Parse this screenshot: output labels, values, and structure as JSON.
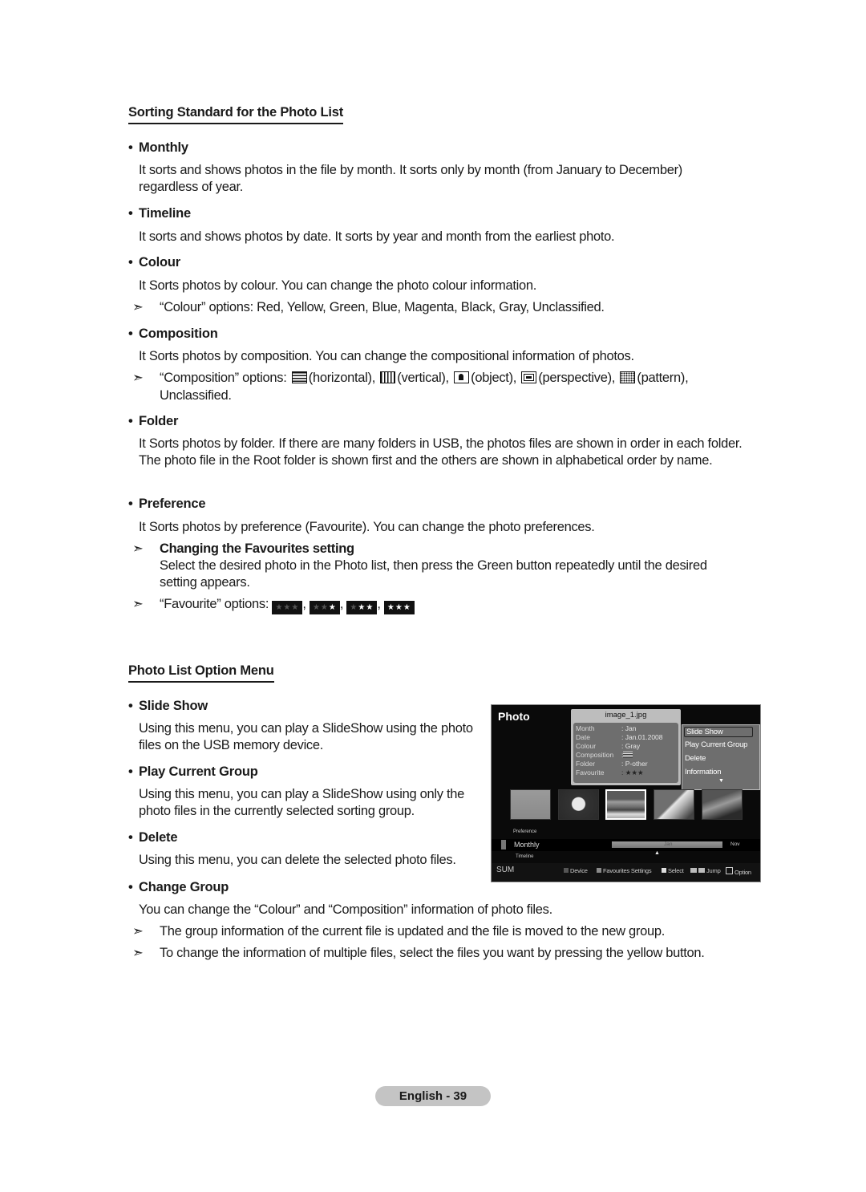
{
  "section1": {
    "title": "Sorting Standard for the Photo List",
    "items": [
      {
        "label": "Monthly",
        "description": "It sorts and shows photos in the file by month. It sorts only by month (from January to December) regardless of year."
      },
      {
        "label": "Timeline",
        "description": "It sorts and shows photos by date. It sorts by year and month from the earliest photo."
      },
      {
        "label": "Colour",
        "description": "It Sorts photos by colour. You can change the photo colour information.",
        "note": "“Colour” options: Red, Yellow, Green, Blue, Magenta, Black, Gray, Unclassified."
      },
      {
        "label": "Composition",
        "description": "It Sorts photos by composition. You can change the compositional information of photos.",
        "note_prefix": "“Composition” options:",
        "options": [
          {
            "icon": "horizontal-composition-icon",
            "label": "(horizontal),"
          },
          {
            "icon": "vertical-composition-icon",
            "label": "(vertical),"
          },
          {
            "icon": "object-composition-icon",
            "label": "(object),"
          },
          {
            "icon": "perspective-composition-icon",
            "label": "(perspective),"
          },
          {
            "icon": "pattern-composition-icon",
            "label": "(pattern),"
          }
        ],
        "note_suffix": "Unclassified."
      },
      {
        "label": "Folder",
        "description": "It Sorts photos by folder. If there are many folders in USB, the photos files are shown in order in each folder. The photo file in the Root folder is shown first and the others are shown in alphabetical order by name."
      },
      {
        "label": "Preference",
        "description": "It Sorts photos by preference (Favourite). You can change the photo preferences.",
        "subnote_title": "Changing the Favourites setting",
        "subnote_text": "Select the desired photo in the Photo list, then press the Green button repeatedly until the desired setting appears.",
        "fav_prefix": "“Favourite” options:",
        "fav_levels": [
          0,
          1,
          2,
          3
        ],
        "star": "★"
      }
    ]
  },
  "section2": {
    "title": "Photo List Option Menu",
    "items": [
      {
        "label": "Slide Show",
        "description": "Using this menu, you can play a SlideShow using the photo files on the USB memory device."
      },
      {
        "label": "Play Current Group",
        "description": "Using this menu, you can play a SlideShow using only the photo files in the currently selected sorting group."
      },
      {
        "label": "Delete",
        "description": "Using this menu, you can delete the selected photo files."
      },
      {
        "label": "Change Group",
        "description": "You can change the “Colour” and “Composition” information of photo files.",
        "notes": [
          "The group information of the current file is updated and the file is moved to the new group.",
          "To change the information of multiple files, select the files you want by pressing the yellow button."
        ]
      }
    ]
  },
  "glyphs": {
    "bullet": "•",
    "arrow": "➣",
    "up": "▲",
    "down": "▼",
    "caret_up": "^",
    "caret_down": "v"
  },
  "tv": {
    "title": "Photo",
    "info": {
      "filename": "image_1.jpg",
      "rows": [
        {
          "key": "Month",
          "value": ": Jan"
        },
        {
          "key": "Date",
          "value": ": Jan.01.2008"
        },
        {
          "key": "Colour",
          "value": ": Gray"
        },
        {
          "key": "Composition",
          "value": ":"
        },
        {
          "key": "Folder",
          "value": ": P-other"
        },
        {
          "key": "Favourite",
          "value": ": ★★★"
        }
      ]
    },
    "option_menu": [
      "Slide Show",
      "Play Current Group",
      "Delete",
      "Information"
    ],
    "option_selected": 0,
    "thumbnails": [
      "sheep",
      "flower",
      "seascape",
      "mountain",
      "palm-tree"
    ],
    "thumbnail_selected": 2,
    "sort": {
      "previous": "Preference",
      "current": "Monthly",
      "next": "Timeline"
    },
    "timeline": {
      "current": "Jan",
      "end": "Nov"
    },
    "footer": {
      "left": "SUM",
      "keys": [
        {
          "color": "#555555",
          "label": "Device"
        },
        {
          "color": "#8a8a8a",
          "label": "Favourites Settings"
        },
        {
          "color": "#dddddd",
          "label": "Select"
        },
        {
          "icon": "jump-icon",
          "label": "Jump"
        },
        {
          "icon": "option-icon",
          "label": "Option"
        }
      ]
    }
  },
  "footer": {
    "page_label": "English - 39"
  }
}
